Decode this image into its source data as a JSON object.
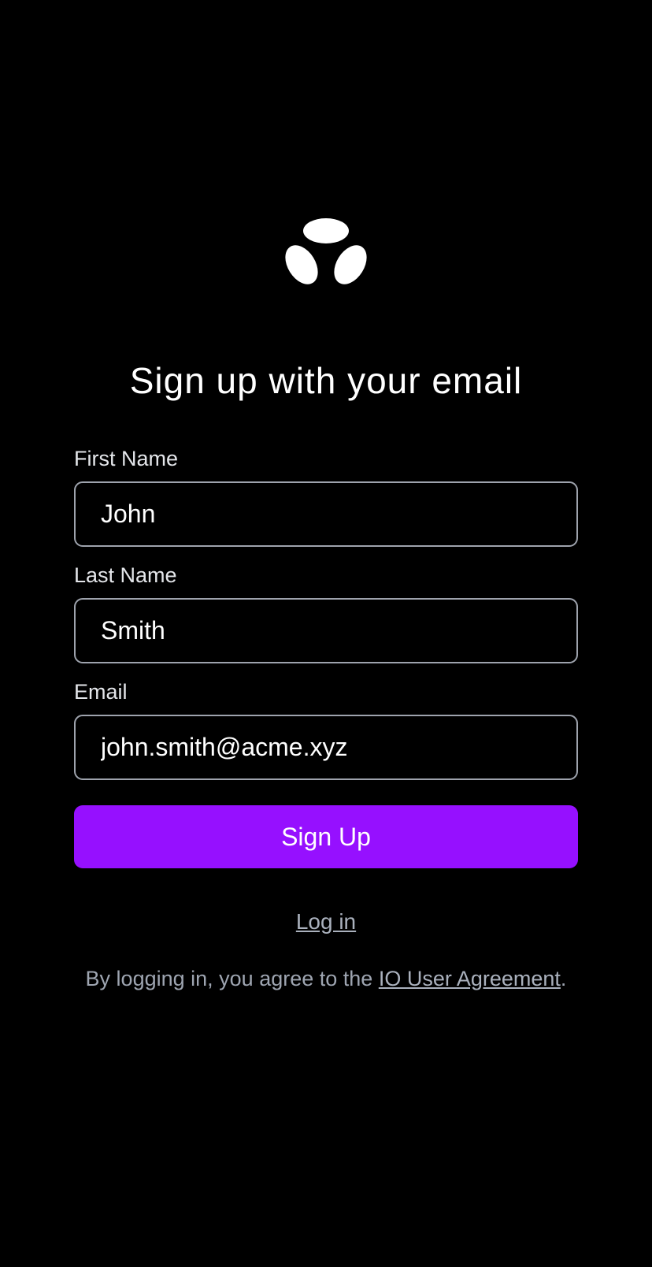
{
  "brand": {
    "logo_icon": "three-petal-logo-icon",
    "logo_color": "#ffffff"
  },
  "title": "Sign up with your email",
  "form": {
    "first_name": {
      "label": "First Name",
      "value": "John"
    },
    "last_name": {
      "label": "Last Name",
      "value": "Smith"
    },
    "email": {
      "label": "Email",
      "value": "john.smith@acme.xyz"
    },
    "submit_label": "Sign Up"
  },
  "login_link": "Log in",
  "terms": {
    "prefix": "By logging in, you agree to the ",
    "link": "IO User Agreement",
    "suffix": "."
  },
  "colors": {
    "background": "#000000",
    "accent": "#9610ff",
    "input_border": "#9ea3ad",
    "muted_text": "#9ea5b1"
  }
}
